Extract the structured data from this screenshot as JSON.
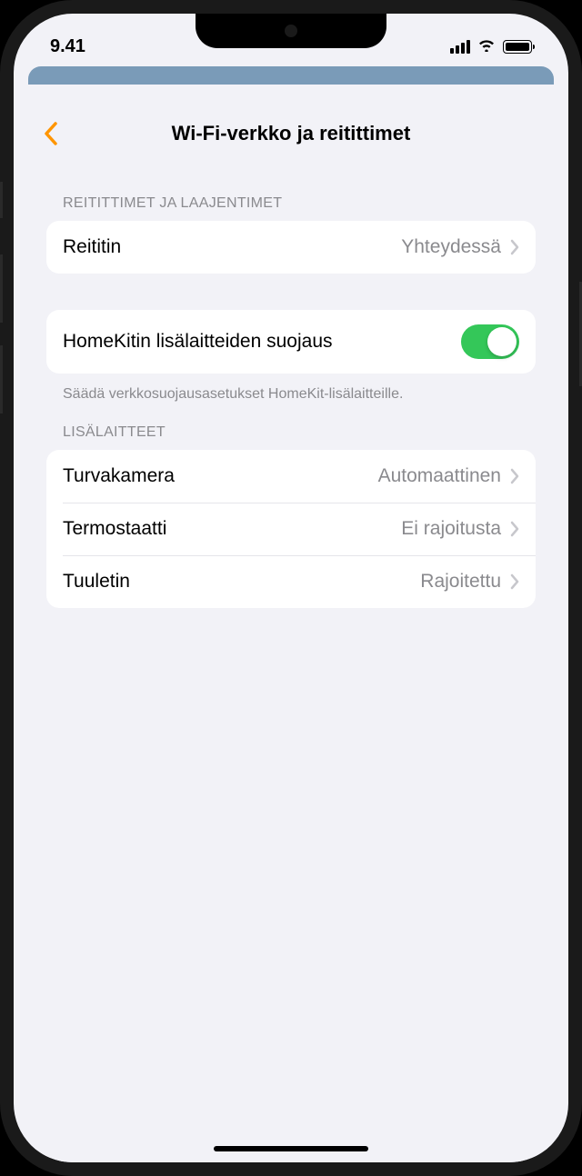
{
  "status": {
    "time": "9.41"
  },
  "nav": {
    "title": "Wi-Fi-verkko ja reitittimet"
  },
  "sections": {
    "routers_header": "REITITTIMET JA LAAJENTIMET",
    "router": {
      "label": "Reititin",
      "value": "Yhteydessä"
    },
    "security": {
      "label": "HomeKitin lisälaitteiden suojaus",
      "enabled": true,
      "footer": "Säädä verkkosuojausasetukset HomeKit-lisälaitteille."
    },
    "accessories_header": "LISÄLAITTEET",
    "accessories": [
      {
        "label": "Turvakamera",
        "value": "Automaattinen"
      },
      {
        "label": "Termostaatti",
        "value": "Ei rajoitusta"
      },
      {
        "label": "Tuuletin",
        "value": "Rajoitettu"
      }
    ]
  }
}
